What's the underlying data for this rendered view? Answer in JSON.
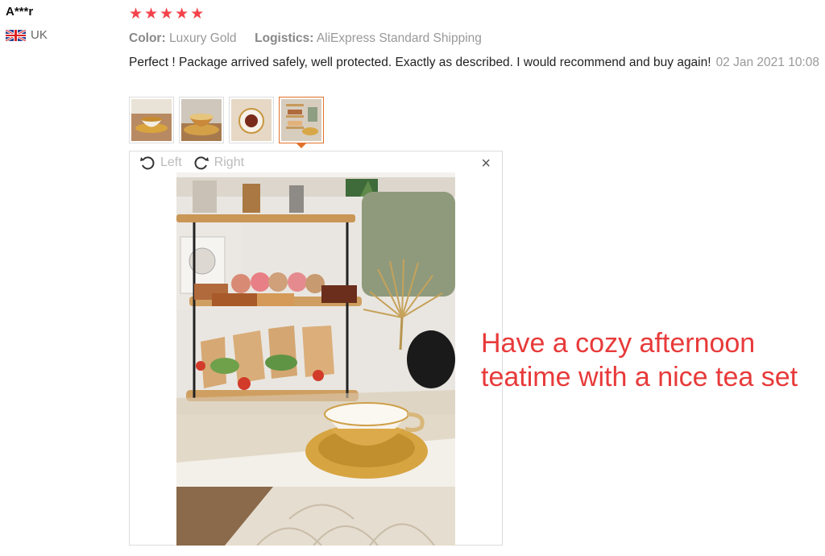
{
  "reviewer": {
    "name": "A***r",
    "country": "UK"
  },
  "rating": {
    "stars": 5,
    "max": 5
  },
  "meta": {
    "color_label": "Color:",
    "color_value": "Luxury Gold",
    "logistics_label": "Logistics:",
    "logistics_value": "AliExpress Standard Shipping"
  },
  "review": {
    "text": "Perfect ! Package arrived safely, well protected. Exactly as described. I would recommend and buy again!",
    "date": "02 Jan 2021 10:08"
  },
  "thumbnails": [
    {
      "name": "photo-thumb-1",
      "active": false
    },
    {
      "name": "photo-thumb-2",
      "active": false
    },
    {
      "name": "photo-thumb-3",
      "active": false
    },
    {
      "name": "photo-thumb-4",
      "active": true
    }
  ],
  "viewer": {
    "rotate_left_label": "Left",
    "rotate_right_label": "Right",
    "close_symbol": "×"
  },
  "caption": {
    "line1": "Have a cozy afternoon",
    "line2": "teatime with a nice tea set"
  },
  "colors": {
    "star": "#f4424a",
    "accent": "#e2712a",
    "caption": "#e83a3a"
  }
}
